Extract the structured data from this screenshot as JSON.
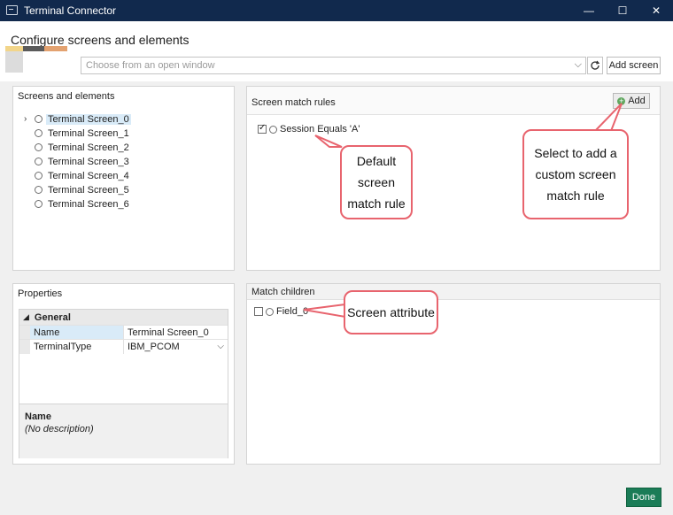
{
  "window": {
    "title": "Terminal Connector",
    "minimize": "—",
    "maximize": "☐",
    "close": "✕"
  },
  "header": {
    "title": "Configure screens and elements",
    "window_select_placeholder": "Choose from an open window",
    "add_screen_label": "Add screen"
  },
  "screens_panel": {
    "title": "Screens and elements",
    "items": [
      {
        "label": "Terminal Screen_0"
      },
      {
        "label": "Terminal Screen_1"
      },
      {
        "label": "Terminal Screen_2"
      },
      {
        "label": "Terminal Screen_3"
      },
      {
        "label": "Terminal Screen_4"
      },
      {
        "label": "Terminal Screen_5"
      },
      {
        "label": "Terminal Screen_6"
      }
    ]
  },
  "rules_panel": {
    "title": "Screen match rules",
    "add_label": "Add",
    "rules": [
      {
        "label": "Session Equals 'A'",
        "checked": true
      }
    ]
  },
  "properties_panel": {
    "title": "Properties",
    "group": "General",
    "rows": [
      {
        "name": "Name",
        "value": "Terminal Screen_0"
      },
      {
        "name": "TerminalType",
        "value": "IBM_PCOM"
      }
    ],
    "desc_title": "Name",
    "desc_text": "(No description)"
  },
  "children_panel": {
    "title": "Match children",
    "items": [
      {
        "label": "Field_0",
        "checked": false
      }
    ]
  },
  "callouts": {
    "default_rule": "Default screen match rule",
    "add_rule": "Select to add a custom screen match rule",
    "screen_attr": "Screen attribute"
  },
  "footer": {
    "done_label": "Done"
  },
  "colors": {
    "titlebar": "#11294d",
    "done": "#1b7c57",
    "callout_border": "#e8646e",
    "selection": "#d9ebf8"
  }
}
